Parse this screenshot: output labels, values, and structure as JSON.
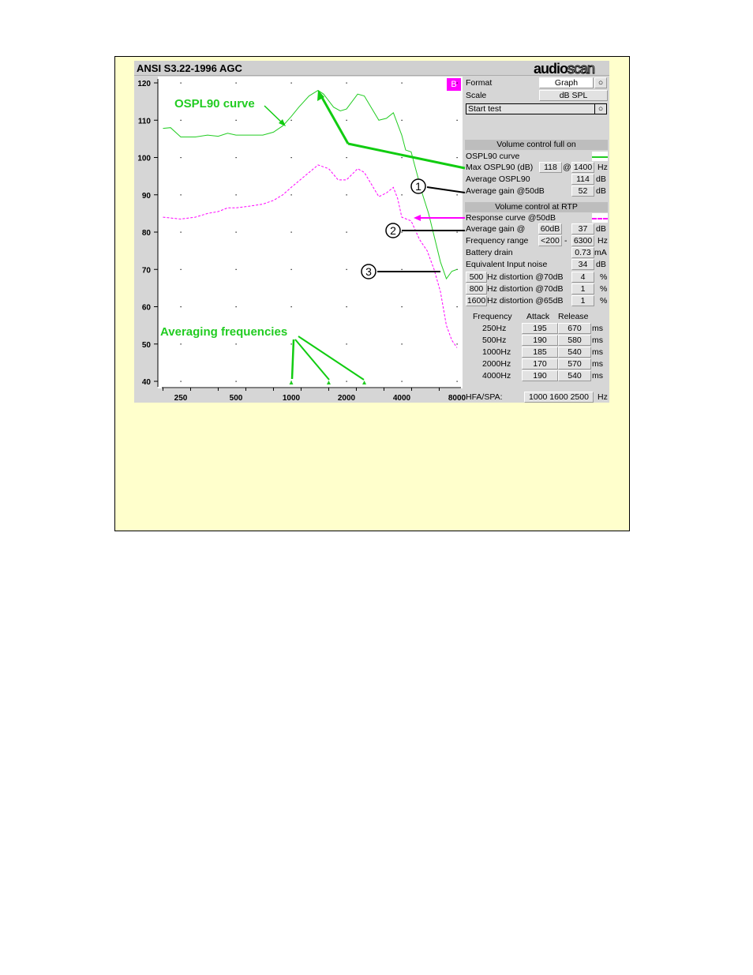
{
  "window": {
    "title": "ANSI S3.22-1996 AGC",
    "logo": "audioscan",
    "badge": "B"
  },
  "colors": {
    "ospl90": "#22cc22",
    "response": "#ff00ff",
    "frame_bg": "#ffffcc",
    "badge": "#ff00ff"
  },
  "controls": {
    "format_label": "Format",
    "format_value": "Graph",
    "scale_label": "Scale",
    "scale_value": "dB SPL",
    "start_test": "Start test"
  },
  "full_on": {
    "header": "Volume control full on",
    "ospl90_curve": "OSPL90 curve",
    "max_label": "Max OSPL90 (dB)",
    "max_value": "118",
    "at": "@",
    "max_freq": "1400",
    "hz": "Hz",
    "avg_label": "Average OSPL90",
    "avg_value": "114",
    "db": "dB",
    "gain_label": "Average gain @50dB",
    "gain_value": "52"
  },
  "rtp": {
    "header": "Volume control at RTP",
    "response_curve": "Response curve @50dB",
    "gain_label": "Average gain @",
    "gain_level": "60dB",
    "gain_value": "37",
    "range_label": "Frequency range",
    "range_low": "<200",
    "dash": "-",
    "range_high": "6300",
    "battery_label": "Battery drain",
    "battery_value": "0.73",
    "ma": "mA",
    "noise_label": "Equivalent Input noise",
    "noise_value": "34",
    "distortion": [
      {
        "freq": "500",
        "label": "Hz distortion @70dB",
        "value": "4"
      },
      {
        "freq": "800",
        "label": "Hz distortion @70dB",
        "value": "1"
      },
      {
        "freq": "1600",
        "label": "Hz distortion @65dB",
        "value": "1"
      }
    ],
    "pct": "%"
  },
  "timing": {
    "headers": [
      "Frequency",
      "Attack",
      "Release"
    ],
    "unit": "ms",
    "rows": [
      [
        "250Hz",
        "195",
        "670"
      ],
      [
        "500Hz",
        "190",
        "580"
      ],
      [
        "1000Hz",
        "185",
        "540"
      ],
      [
        "2000Hz",
        "170",
        "570"
      ],
      [
        "4000Hz",
        "190",
        "540"
      ]
    ]
  },
  "hfa": {
    "label": "HFA/SPA:",
    "value": "1000 1600 2500",
    "unit": "Hz"
  },
  "annotations": {
    "ospl90": "OSPL90 curve",
    "averaging": "Averaging frequencies",
    "callouts": [
      "1",
      "2",
      "3"
    ]
  },
  "chart_data": {
    "type": "line",
    "xscale": "log",
    "xlim": [
      200,
      8000
    ],
    "ylim": [
      40,
      120
    ],
    "xticks": [
      250,
      500,
      1000,
      2000,
      4000,
      8000
    ],
    "yticks": [
      40,
      50,
      60,
      70,
      80,
      90,
      100,
      110,
      120
    ],
    "grid": "dots",
    "averaging_frequencies": [
      1000,
      1600,
      2500
    ],
    "series": [
      {
        "name": "OSPL90 curve",
        "style": "solid",
        "color": "#22cc22",
        "points": [
          [
            200,
            107.8
          ],
          [
            220,
            108
          ],
          [
            250,
            105.5
          ],
          [
            300,
            105.5
          ],
          [
            350,
            106
          ],
          [
            400,
            105.7
          ],
          [
            450,
            106.5
          ],
          [
            500,
            106
          ],
          [
            600,
            106
          ],
          [
            700,
            106
          ],
          [
            800,
            106.8
          ],
          [
            900,
            108.5
          ],
          [
            1000,
            111
          ],
          [
            1100,
            113.5
          ],
          [
            1250,
            116.5
          ],
          [
            1400,
            118
          ],
          [
            1500,
            117
          ],
          [
            1700,
            113.5
          ],
          [
            1850,
            112.5
          ],
          [
            2000,
            113
          ],
          [
            2300,
            117
          ],
          [
            2500,
            116.5
          ],
          [
            3000,
            110
          ],
          [
            3300,
            110.5
          ],
          [
            3600,
            112
          ],
          [
            4000,
            106
          ],
          [
            4200,
            102
          ],
          [
            4500,
            101.5
          ],
          [
            4700,
            98
          ],
          [
            5200,
            90
          ],
          [
            5600,
            85
          ],
          [
            6000,
            79
          ],
          [
            6500,
            72
          ],
          [
            7000,
            67.5
          ],
          [
            7500,
            69.5
          ],
          [
            8000,
            70
          ]
        ]
      },
      {
        "name": "Response curve @50dB",
        "style": "dashed",
        "color": "#ff00ff",
        "points": [
          [
            200,
            84
          ],
          [
            250,
            83.5
          ],
          [
            300,
            84
          ],
          [
            350,
            85
          ],
          [
            400,
            85.5
          ],
          [
            450,
            86.5
          ],
          [
            500,
            86.5
          ],
          [
            600,
            87
          ],
          [
            700,
            87.5
          ],
          [
            800,
            88.5
          ],
          [
            900,
            90
          ],
          [
            1000,
            92
          ],
          [
            1150,
            94.5
          ],
          [
            1400,
            98
          ],
          [
            1600,
            97
          ],
          [
            1800,
            94
          ],
          [
            2000,
            94
          ],
          [
            2300,
            97
          ],
          [
            2500,
            96
          ],
          [
            3000,
            89.5
          ],
          [
            3300,
            90.5
          ],
          [
            3600,
            92
          ],
          [
            3800,
            89
          ],
          [
            4000,
            84
          ],
          [
            4500,
            83
          ],
          [
            5000,
            78
          ],
          [
            5500,
            75
          ],
          [
            6000,
            70
          ],
          [
            6500,
            64
          ],
          [
            7000,
            55
          ],
          [
            7500,
            51
          ],
          [
            8000,
            49
          ]
        ]
      }
    ]
  }
}
